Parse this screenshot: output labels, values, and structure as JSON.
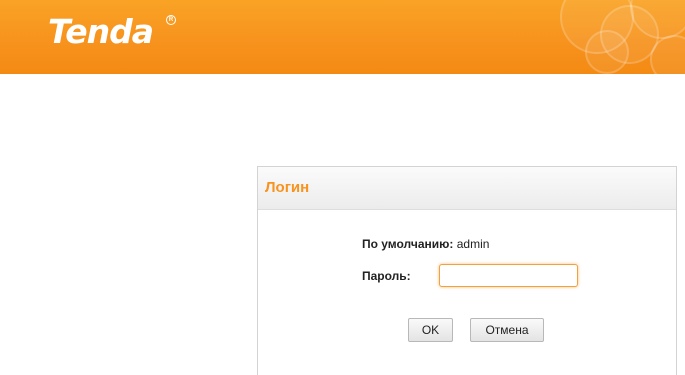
{
  "header": {
    "logo_text": "Tenda",
    "logo_mark": "R",
    "background_color": "#f7931e"
  },
  "login": {
    "title": "Логин",
    "default_label": "По умолчанию:",
    "default_value": "admin",
    "password_label": "Пароль:",
    "password_value": "",
    "ok_label": "OK",
    "cancel_label": "Отмена"
  }
}
